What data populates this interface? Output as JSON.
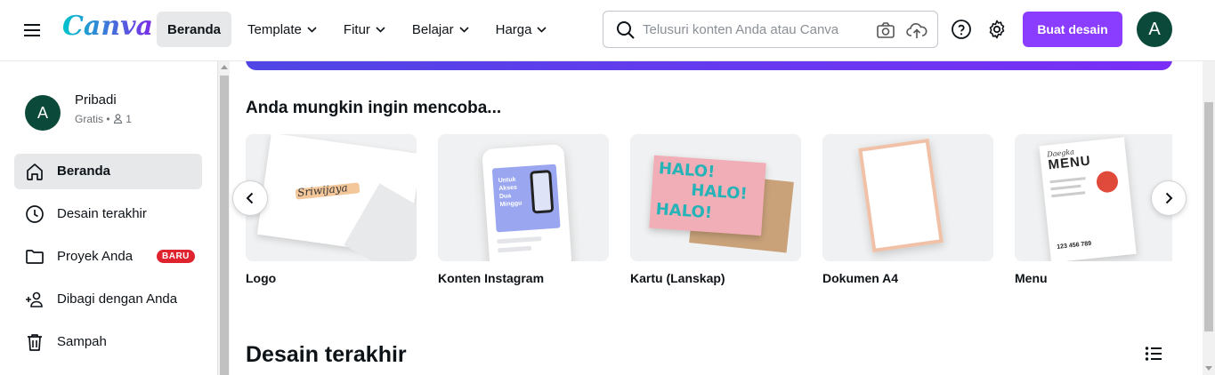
{
  "header": {
    "logo": "Canva",
    "nav": [
      {
        "label": "Beranda",
        "active": true,
        "dropdown": false
      },
      {
        "label": "Template",
        "active": false,
        "dropdown": true
      },
      {
        "label": "Fitur",
        "active": false,
        "dropdown": true
      },
      {
        "label": "Belajar",
        "active": false,
        "dropdown": true
      },
      {
        "label": "Harga",
        "active": false,
        "dropdown": true
      }
    ],
    "search_placeholder": "Telusuri konten Anda atau Canva",
    "create_label": "Buat desain",
    "avatar_initial": "A",
    "accent": "#8b3dff"
  },
  "sidebar": {
    "profile": {
      "initial": "A",
      "name": "Pribadi",
      "plan": "Gratis",
      "members": "1"
    },
    "items": [
      {
        "label": "Beranda",
        "icon": "home-icon",
        "active": true
      },
      {
        "label": "Desain terakhir",
        "icon": "clock-icon",
        "active": false
      },
      {
        "label": "Proyek Anda",
        "icon": "folder-icon",
        "active": false,
        "badge": "BARU"
      },
      {
        "label": "Dibagi dengan Anda",
        "icon": "shared-users-icon",
        "active": false
      },
      {
        "label": "Sampah",
        "icon": "trash-icon",
        "active": false
      }
    ]
  },
  "main": {
    "suggest_title": "Anda mungkin ingin mencoba...",
    "cards": [
      {
        "label": "Logo",
        "thumb_text": "Sriwijaya"
      },
      {
        "label": "Konten Instagram",
        "thumb_text": "Untuk Akses Dua Minggu"
      },
      {
        "label": "Kartu (Lanskap)",
        "thumb_text": "HALO!"
      },
      {
        "label": "Dokumen A4",
        "thumb_text": ""
      },
      {
        "label": "Menu",
        "thumb_text": "MENU",
        "thumb_sub": "123 456 789",
        "thumb_script": "Daegka"
      }
    ],
    "recent_title": "Desain terakhir"
  }
}
